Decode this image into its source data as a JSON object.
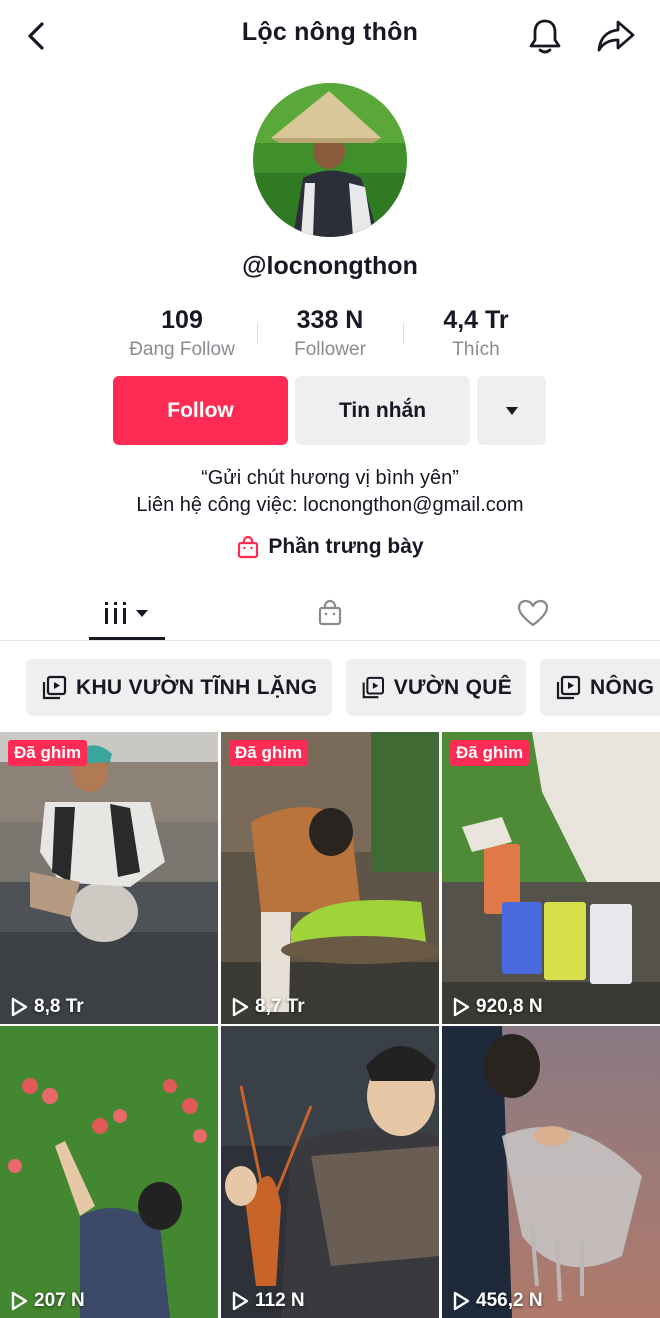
{
  "header": {
    "title": "Lộc nông thôn"
  },
  "profile": {
    "handle": "@locnongthon",
    "stats": [
      {
        "value": "109",
        "label": "Đang Follow"
      },
      {
        "value": "338 N",
        "label": "Follower"
      },
      {
        "value": "4,4 Tr",
        "label": "Thích"
      }
    ],
    "follow_label": "Follow",
    "message_label": "Tin nhắn",
    "bio_line1": "“Gửi chút hương vị bình yên”",
    "bio_line2": "Liên hệ công việc: locnongthon@gmail.com",
    "showcase_label": "Phần trưng bày"
  },
  "playlists": [
    {
      "label": "KHU VƯỜN TĨNH LẶNG"
    },
    {
      "label": "VƯỜN QUÊ"
    },
    {
      "label": "NÔNG"
    }
  ],
  "videos": [
    {
      "pinned": "Đã ghim",
      "views": "8,8 Tr"
    },
    {
      "pinned": "Đã ghim",
      "views": "8,7 Tr"
    },
    {
      "pinned": "Đã ghim",
      "views": "920,8 N"
    },
    {
      "pinned": "",
      "views": "207 N"
    },
    {
      "pinned": "",
      "views": "112 N"
    },
    {
      "pinned": "",
      "views": "456,2 N"
    }
  ],
  "colors": {
    "accent": "#fe2c55",
    "text": "#161823",
    "muted": "#8a8b91",
    "button_gray": "#efefef"
  },
  "icons": [
    "back-arrow",
    "bell",
    "share-arrow",
    "dropdown-caret",
    "shopping-bag",
    "grid-view",
    "heart",
    "playlist",
    "play"
  ]
}
